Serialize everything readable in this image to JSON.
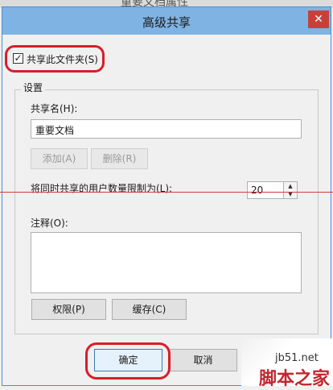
{
  "background_window": {
    "title": "重要文档属性"
  },
  "dialog": {
    "title": "高级共享",
    "close_label": "✕",
    "share_checkbox": {
      "label": "共享此文件夹(S)",
      "checked": true
    },
    "settings": {
      "legend": "设置",
      "share_name_label": "共享名(H):",
      "share_name_value": "重要文档",
      "add_label": "添加(A)",
      "remove_label": "删除(R)",
      "user_limit_label": "将同时共享的用户数量限制为(L):",
      "user_limit_value": "20",
      "comment_label": "注释(O):",
      "comment_value": "",
      "permissions_label": "权限(P)",
      "cache_label": "缓存(C)"
    },
    "ok_label": "确定",
    "cancel_label": "取消"
  },
  "watermark": {
    "site": "jb51.net",
    "brand": "脚本之家"
  },
  "colors": {
    "titlebar": "#7fb3e3",
    "close": "#c7413a",
    "annotation": "#d81e2a"
  }
}
